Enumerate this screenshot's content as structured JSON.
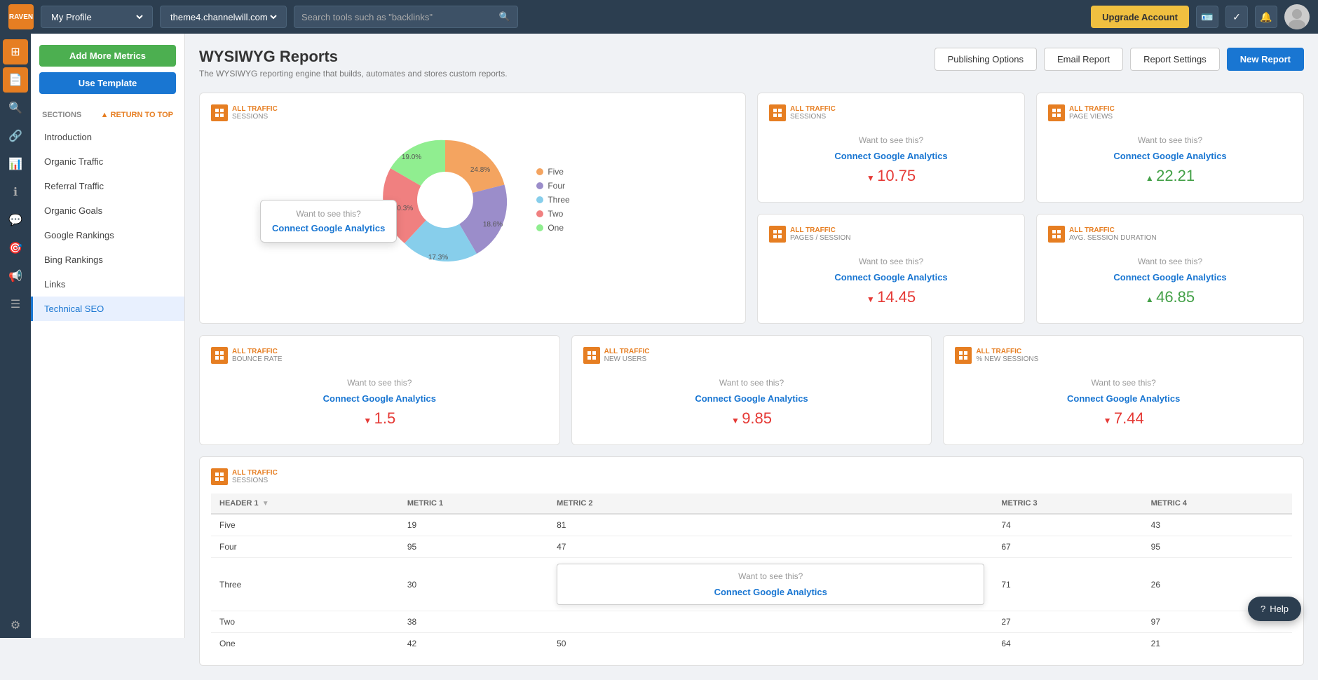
{
  "app": {
    "logo_text": "RAVEN"
  },
  "top_nav": {
    "profile_label": "My Profile",
    "domain_label": "theme4.channelwill.com",
    "search_placeholder": "Search tools such as \"backlinks\"",
    "upgrade_btn": "Upgrade Account"
  },
  "left_sidebar": {
    "icons": [
      {
        "name": "grid-icon",
        "symbol": "⊞",
        "active": false
      },
      {
        "name": "file-icon",
        "symbol": "📄",
        "active": true
      },
      {
        "name": "search-icon",
        "symbol": "🔍",
        "active": false
      },
      {
        "name": "link-icon",
        "symbol": "🔗",
        "active": false
      },
      {
        "name": "chart-icon",
        "symbol": "📊",
        "active": false
      },
      {
        "name": "info-icon",
        "symbol": "ℹ",
        "active": false
      },
      {
        "name": "comment-icon",
        "symbol": "💬",
        "active": false
      },
      {
        "name": "target-icon",
        "symbol": "🎯",
        "active": false
      },
      {
        "name": "megaphone-icon",
        "symbol": "📢",
        "active": false
      },
      {
        "name": "list-icon",
        "symbol": "☰",
        "active": false
      },
      {
        "name": "settings-icon",
        "symbol": "⚙",
        "active": false
      }
    ]
  },
  "second_sidebar": {
    "add_metrics_btn": "Add More Metrics",
    "use_template_btn": "Use Template",
    "sections_header": "SECTIONS",
    "return_top": "RETURN TO TOP",
    "nav_items": [
      {
        "label": "Introduction",
        "active": false
      },
      {
        "label": "Organic Traffic",
        "active": false
      },
      {
        "label": "Referral Traffic",
        "active": false
      },
      {
        "label": "Organic Goals",
        "active": false
      },
      {
        "label": "Google Rankings",
        "active": false
      },
      {
        "label": "Bing Rankings",
        "active": false
      },
      {
        "label": "Links",
        "active": false
      },
      {
        "label": "Technical SEO",
        "active": true
      }
    ]
  },
  "page": {
    "title": "WYSIWYG Reports",
    "subtitle": "The WYSIWYG reporting engine that builds, automates and stores custom reports.",
    "buttons": {
      "publishing_options": "Publishing Options",
      "email_report": "Email Report",
      "report_settings": "Report Settings",
      "new_report": "New Report"
    }
  },
  "pie_card": {
    "title": "ALL TRAFFIC",
    "subtitle": "SESSIONS",
    "tooltip": {
      "want_text": "Want to see this?",
      "connect_text": "Connect Google Analytics"
    },
    "slices": [
      {
        "label": "Five",
        "color": "#f4a460",
        "percent": 24.8,
        "startAngle": 0
      },
      {
        "label": "Four",
        "color": "#9b8dca",
        "percent": 18.6,
        "startAngle": 89.3
      },
      {
        "label": "Three",
        "color": "#87ceeb",
        "percent": 17.3,
        "startAngle": 156.2
      },
      {
        "label": "Two",
        "color": "#f08080",
        "percent": 20.3,
        "startAngle": 218.5
      },
      {
        "label": "One",
        "color": "#90ee90",
        "percent": 19.0,
        "startAngle": 291.7
      }
    ],
    "labels": [
      {
        "text": "24.8%",
        "angle": 44.6,
        "color": "#fff"
      },
      {
        "text": "18.6%",
        "angle": 122.7,
        "color": "#fff"
      },
      {
        "text": "17.3%",
        "angle": 187.3,
        "color": "#fff"
      },
      {
        "text": "20.3%",
        "angle": 255.1,
        "color": "#fff"
      },
      {
        "text": "19.0%",
        "angle": 326.5,
        "color": "#fff"
      }
    ]
  },
  "top_cards_right": [
    {
      "title": "ALL TRAFFIC",
      "subtitle": "SESSIONS",
      "want_text": "Want to see this?",
      "connect_text": "Connect Google Analytics",
      "value": "10.75",
      "direction": "down"
    },
    {
      "title": "ALL TRAFFIC",
      "subtitle": "PAGE VIEWS",
      "want_text": "Want to see this?",
      "connect_text": "Connect Google Analytics",
      "value": "22.21",
      "direction": "up"
    },
    {
      "title": "ALL TRAFFIC",
      "subtitle": "PAGES / SESSION",
      "want_text": "Want to see this?",
      "connect_text": "Connect Google Analytics",
      "value": "14.45",
      "direction": "down"
    },
    {
      "title": "ALL TRAFFIC",
      "subtitle": "AVG. SESSION DURATION",
      "want_text": "Want to see this?",
      "connect_text": "Connect Google Analytics",
      "value": "46.85",
      "direction": "up"
    }
  ],
  "bottom_cards": [
    {
      "title": "ALL TRAFFIC",
      "subtitle": "BOUNCE RATE",
      "want_text": "Want to see this?",
      "connect_text": "Connect Google Analytics",
      "value": "1.5",
      "direction": "down"
    },
    {
      "title": "ALL TRAFFIC",
      "subtitle": "NEW USERS",
      "want_text": "Want to see this?",
      "connect_text": "Connect Google Analytics",
      "value": "9.85",
      "direction": "down"
    },
    {
      "title": "ALL TRAFFIC",
      "subtitle": "% NEW SESSIONS",
      "want_text": "Want to see this?",
      "connect_text": "Connect Google Analytics",
      "value": "7.44",
      "direction": "down"
    }
  ],
  "table": {
    "title": "ALL TRAFFIC",
    "subtitle": "SESSIONS",
    "headers": [
      "HEADER 1",
      "METRIC 1",
      "METRIC 2",
      "METRIC 3",
      "METRIC 4"
    ],
    "rows": [
      {
        "col0": "Five",
        "col1": "19",
        "col2": "81",
        "col3": "74",
        "col4": "43",
        "show_connect": false
      },
      {
        "col0": "Four",
        "col1": "95",
        "col2": "47",
        "col3": "67",
        "col4": "95",
        "show_connect": false
      },
      {
        "col0": "Three",
        "col1": "30",
        "col2": "",
        "col3": "71",
        "col4": "26",
        "show_connect": true
      },
      {
        "col0": "Two",
        "col1": "38",
        "col2": "",
        "col3": "27",
        "col4": "97",
        "show_connect": false
      },
      {
        "col0": "One",
        "col1": "42",
        "col2": "50",
        "col3": "64",
        "col4": "21",
        "show_connect": false
      }
    ],
    "connect_overlay": {
      "want_text": "Want to see this?",
      "connect_text": "Connect Google Analytics"
    }
  },
  "colors": {
    "orange": "#e67e22",
    "blue": "#1976d2",
    "green": "#4caf50",
    "red": "#e53935",
    "up_green": "#43a047"
  }
}
